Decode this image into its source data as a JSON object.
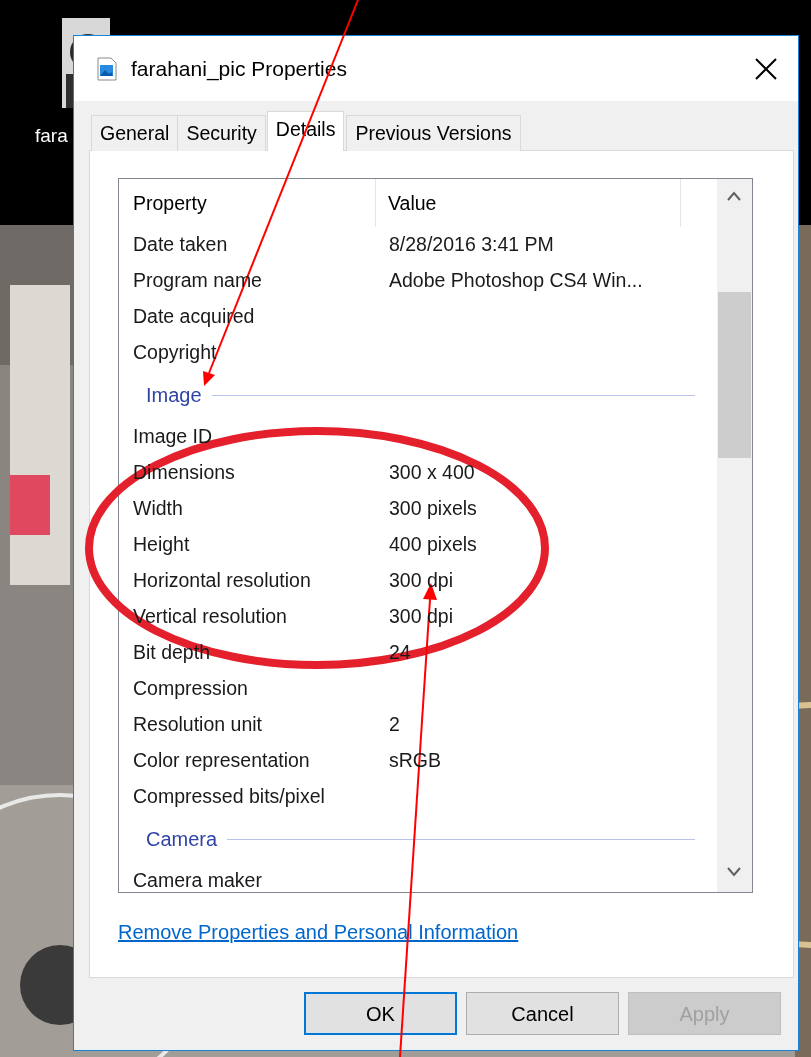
{
  "desktop": {
    "icon_label": "fara"
  },
  "window": {
    "title": "farahani_pic Properties"
  },
  "tabs": [
    {
      "label": "General",
      "selected": false
    },
    {
      "label": "Security",
      "selected": false
    },
    {
      "label": "Details",
      "selected": true
    },
    {
      "label": "Previous Versions",
      "selected": false
    }
  ],
  "list": {
    "columns": [
      "Property",
      "Value"
    ],
    "rows": [
      {
        "kind": "property",
        "name": "Date taken",
        "value": "8/28/2016 3:41 PM"
      },
      {
        "kind": "property",
        "name": "Program name",
        "value": "Adobe Photoshop CS4 Win..."
      },
      {
        "kind": "property",
        "name": "Date acquired"
      },
      {
        "kind": "property",
        "name": "Copyright"
      },
      {
        "kind": "group",
        "name": "Image"
      },
      {
        "kind": "property",
        "name": "Image ID"
      },
      {
        "kind": "property",
        "name": "Dimensions",
        "value": "300 x 400"
      },
      {
        "kind": "property",
        "name": "Width",
        "value": "300 pixels"
      },
      {
        "kind": "property",
        "name": "Height",
        "value": "400 pixels"
      },
      {
        "kind": "property",
        "name": "Horizontal resolution",
        "value": "300 dpi"
      },
      {
        "kind": "property",
        "name": "Vertical resolution",
        "value": "300 dpi"
      },
      {
        "kind": "property",
        "name": "Bit depth",
        "value": "24"
      },
      {
        "kind": "property",
        "name": "Compression"
      },
      {
        "kind": "property",
        "name": "Resolution unit",
        "value": "2"
      },
      {
        "kind": "property",
        "name": "Color representation",
        "value": "sRGB"
      },
      {
        "kind": "property",
        "name": "Compressed bits/pixel"
      },
      {
        "kind": "group",
        "name": "Camera"
      },
      {
        "kind": "property",
        "name": "Camera maker"
      }
    ]
  },
  "link": "Remove Properties and Personal Information",
  "buttons": [
    {
      "label": "OK",
      "default": true,
      "disabled": false
    },
    {
      "label": "Cancel",
      "default": false,
      "disabled": false
    },
    {
      "label": "Apply",
      "default": false,
      "disabled": true
    }
  ],
  "annotations": [
    {
      "kind": "arrow"
    },
    {
      "kind": "ellipse"
    },
    {
      "kind": "arrow"
    }
  ]
}
